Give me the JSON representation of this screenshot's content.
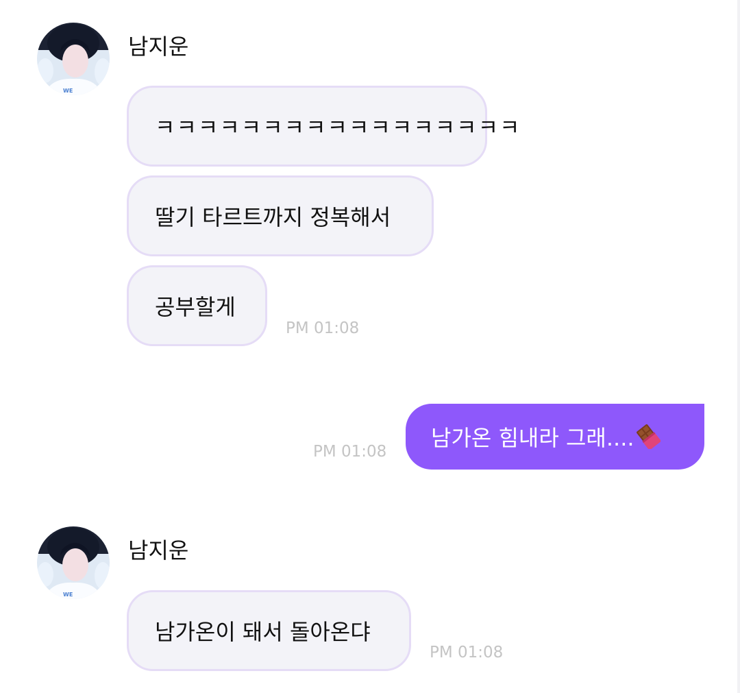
{
  "conversation": {
    "group1": {
      "sender_name": "남지운",
      "messages": [
        "ㅋㅋㅋㅋㅋㅋㅋㅋㅋㅋㅋㅋㅋㅋㅋㅋㅋ",
        "딸기 타르트까지 정복해서",
        "공부할게"
      ],
      "timestamp": "PM 01:08"
    },
    "outgoing": {
      "text": "남가온 힘내라 그래....",
      "emoji": "chocolate-bar-icon",
      "timestamp": "PM 01:08"
    },
    "group2": {
      "sender_name": "남지운",
      "messages": [
        "남가온이 돼서 돌아온댜"
      ],
      "timestamp": "PM 01:08"
    }
  },
  "colors": {
    "incoming_bubble_bg": "#f3f3f8",
    "incoming_bubble_border": "#e5dcf6",
    "outgoing_bubble_bg": "#8e58fb",
    "timestamp": "#c4c4c4"
  }
}
